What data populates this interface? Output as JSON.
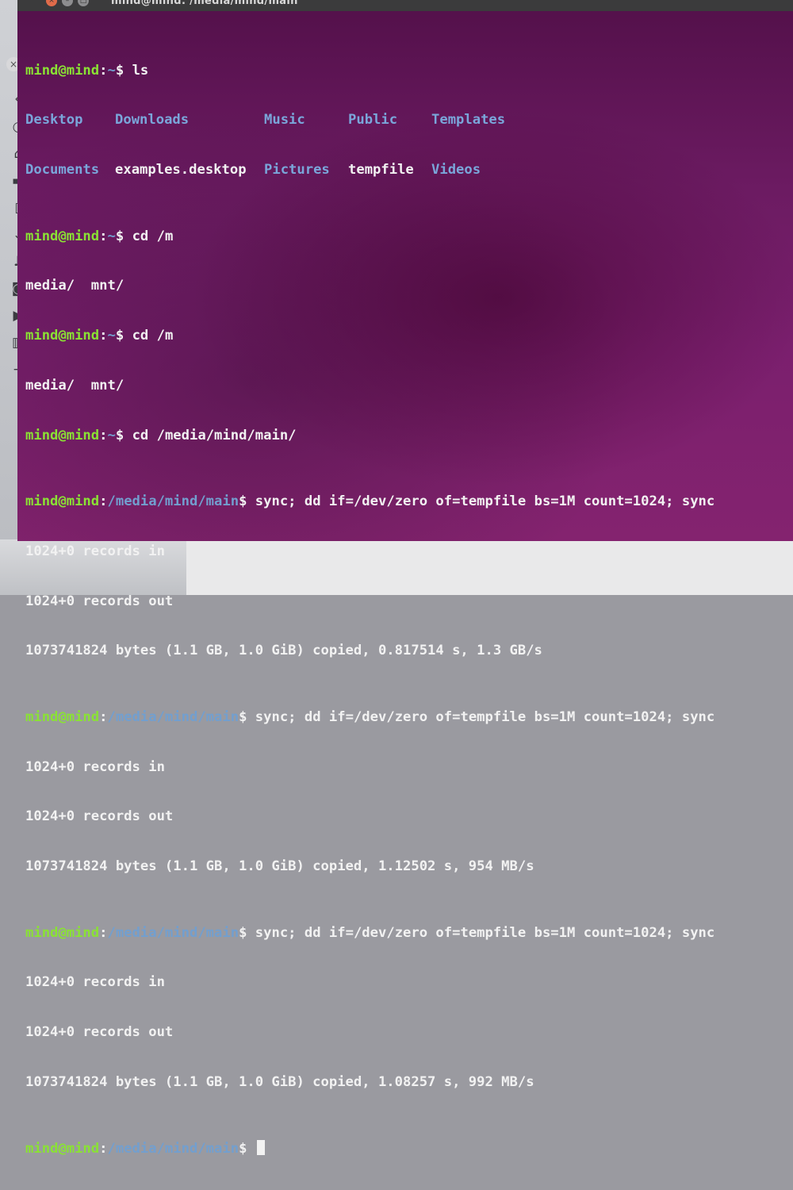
{
  "window": {
    "title": "mind@mind: /media/mind/main",
    "buttons": {
      "close": "×",
      "minimize": "–",
      "maximize": "□"
    }
  },
  "desktop": {
    "launcher_icons": [
      "clock-icon",
      "home-icon",
      "folder-icon",
      "document-icon",
      "download-icon",
      "music-icon",
      "camera-icon",
      "video-icon",
      "trash-icon",
      "plus-icon"
    ],
    "launcher_glyphs": [
      "◷",
      "⌂",
      "▬",
      "▯",
      "⇣",
      "♫",
      "◙",
      "▶",
      "▥",
      "+"
    ],
    "back_chevron": "‹",
    "close_glyph": "×"
  },
  "terminal": {
    "prompt_user": "mind@mind",
    "home_path": "~",
    "main_path": "/media/mind/main",
    "cmd_ls": "ls",
    "ls_output": [
      [
        "Desktop",
        "Downloads",
        "Music",
        "Public",
        "Templates"
      ],
      [
        "Documents",
        "examples.desktop",
        "Pictures",
        "tempfile",
        "Videos"
      ]
    ],
    "cmd_cd_m": "cd /m",
    "completion": "media/  mnt/",
    "cmd_cd_main": "cd /media/mind/main/",
    "cmd_dd": "sync; dd if=/dev/zero of=tempfile bs=1M count=1024; sync",
    "records_in": "1024+0 records in",
    "records_out": "1024+0 records out",
    "results": [
      "1073741824 bytes (1.1 GB, 1.0 GiB) copied, 0.817514 s, 1.3 GB/s",
      "1073741824 bytes (1.1 GB, 1.0 GiB) copied, 1.12502 s, 954 MB/s",
      "1073741824 bytes (1.1 GB, 1.0 GiB) copied, 1.08257 s, 992 MB/s"
    ]
  }
}
